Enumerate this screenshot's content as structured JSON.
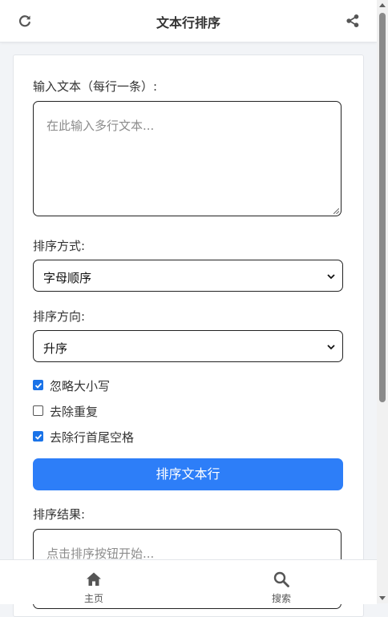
{
  "header": {
    "title": "文本行排序",
    "refresh_icon": "refresh-icon",
    "share_icon": "share-icon"
  },
  "form": {
    "input_label": "输入文本（每行一条）:",
    "input_placeholder": "在此输入多行文本...",
    "sort_method_label": "排序方式:",
    "sort_method_value": "字母顺序",
    "sort_direction_label": "排序方向:",
    "sort_direction_value": "升序",
    "options": [
      {
        "label": "忽略大小写",
        "checked": true
      },
      {
        "label": "去除重复",
        "checked": false
      },
      {
        "label": "去除行首尾空格",
        "checked": true
      }
    ],
    "sort_button_label": "排序文本行",
    "result_label": "排序结果:",
    "result_placeholder": "点击排序按钮开始..."
  },
  "bottom_nav": {
    "items": [
      {
        "label": "主页",
        "icon": "home-icon"
      },
      {
        "label": "搜索",
        "icon": "search-icon"
      }
    ]
  },
  "colors": {
    "accent": "#2d7ef8",
    "checkbox": "#1a73e8"
  }
}
